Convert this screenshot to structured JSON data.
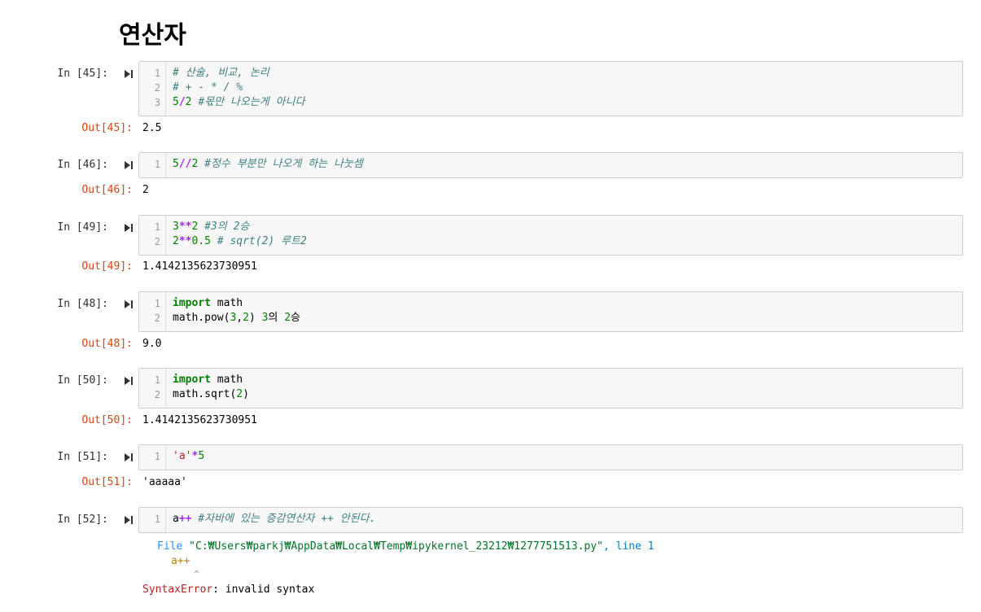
{
  "heading": "연산자",
  "cells": [
    {
      "in_label": "In [45]:",
      "lines": [
        {
          "num": "1",
          "segs": [
            {
              "t": "# 산술, 비교, 논리",
              "c": "cm"
            }
          ]
        },
        {
          "num": "2",
          "segs": [
            {
              "t": "# + - * / %",
              "c": "cm"
            }
          ]
        },
        {
          "num": "3",
          "segs": [
            {
              "t": "5",
              "c": "num"
            },
            {
              "t": "/",
              "c": "op"
            },
            {
              "t": "2 ",
              "c": "num"
            },
            {
              "t": "#몫만 나오는게 아니다",
              "c": "cm"
            }
          ]
        }
      ],
      "out_label": "Out[45]:",
      "output": "2.5"
    },
    {
      "in_label": "In [46]:",
      "lines": [
        {
          "num": "1",
          "segs": [
            {
              "t": "5",
              "c": "num"
            },
            {
              "t": "//",
              "c": "op"
            },
            {
              "t": "2 ",
              "c": "num"
            },
            {
              "t": "#정수 부분만 나오게 하는 나눗셈",
              "c": "cm"
            }
          ]
        }
      ],
      "out_label": "Out[46]:",
      "output": "2"
    },
    {
      "in_label": "In [49]:",
      "lines": [
        {
          "num": "1",
          "segs": [
            {
              "t": "3",
              "c": "num"
            },
            {
              "t": "**",
              "c": "op"
            },
            {
              "t": "2 ",
              "c": "num"
            },
            {
              "t": "#3의 2승",
              "c": "cm"
            }
          ]
        },
        {
          "num": "2",
          "segs": [
            {
              "t": "2",
              "c": "num"
            },
            {
              "t": "**",
              "c": "op"
            },
            {
              "t": "0.5 ",
              "c": "num"
            },
            {
              "t": "# sqrt(2) 루트2",
              "c": "cm"
            }
          ]
        }
      ],
      "out_label": "Out[49]:",
      "output": "1.4142135623730951"
    },
    {
      "in_label": "In [48]:",
      "lines": [
        {
          "num": "1",
          "segs": [
            {
              "t": "import",
              "c": "kw"
            },
            {
              "t": " math",
              "c": "plain"
            }
          ]
        },
        {
          "num": "2",
          "segs": [
            {
              "t": "math.pow(",
              "c": "plain"
            },
            {
              "t": "3",
              "c": "num"
            },
            {
              "t": ",",
              "c": "plain"
            },
            {
              "t": "2",
              "c": "num"
            },
            {
              "t": ") ",
              "c": "plain"
            },
            {
              "t": "3",
              "c": "num"
            },
            {
              "t": "의 ",
              "c": "plain"
            },
            {
              "t": "2",
              "c": "num"
            },
            {
              "t": "승",
              "c": "plain"
            }
          ]
        }
      ],
      "out_label": "Out[48]:",
      "output": "9.0"
    },
    {
      "in_label": "In [50]:",
      "lines": [
        {
          "num": "1",
          "segs": [
            {
              "t": "import",
              "c": "kw"
            },
            {
              "t": " math",
              "c": "plain"
            }
          ]
        },
        {
          "num": "2",
          "segs": [
            {
              "t": "math.sqrt(",
              "c": "plain"
            },
            {
              "t": "2",
              "c": "num"
            },
            {
              "t": ")",
              "c": "plain"
            }
          ]
        }
      ],
      "out_label": "Out[50]:",
      "output": "1.4142135623730951"
    },
    {
      "in_label": "In [51]:",
      "lines": [
        {
          "num": "1",
          "segs": [
            {
              "t": "'a'",
              "c": "str"
            },
            {
              "t": "*",
              "c": "op"
            },
            {
              "t": "5",
              "c": "num"
            }
          ]
        }
      ],
      "out_label": "Out[51]:",
      "output": "'aaaaa'"
    },
    {
      "in_label": "In [52]:",
      "lines": [
        {
          "num": "1",
          "segs": [
            {
              "t": "a",
              "c": "plain"
            },
            {
              "t": "++",
              "c": "op"
            },
            {
              "t": " #자바에 있는 증감연산자 ++ 안된다.",
              "c": "cm"
            }
          ]
        }
      ],
      "out_label": "",
      "output": ""
    }
  ],
  "traceback": {
    "file_word": "File",
    "file_path": "\"C:₩Users₩parkj₩AppData₩Local₩Temp₩ipykernel_23212₩1277751513.py\"",
    "line_word": ", line 1",
    "code": "a++",
    "caret": "^",
    "error_name": "SyntaxError",
    "error_msg": ": invalid syntax"
  },
  "colors": {
    "out_prompt": "#d84315",
    "comment": "#408080",
    "number": "#008000",
    "operator": "#aa22ff",
    "keyword": "#008000",
    "string": "#ba2121"
  }
}
